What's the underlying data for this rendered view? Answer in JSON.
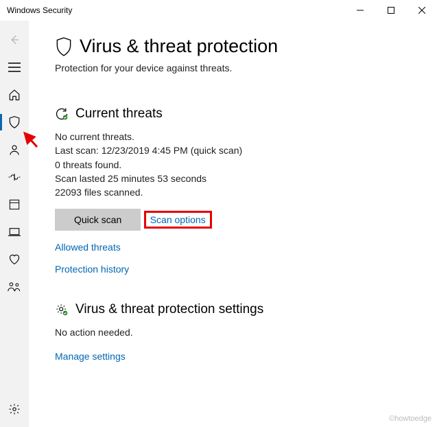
{
  "window": {
    "title": "Windows Security"
  },
  "page": {
    "title": "Virus & threat protection",
    "subtitle": "Protection for your device against threats."
  },
  "current_threats": {
    "heading": "Current threats",
    "line1": "No current threats.",
    "line2": "Last scan: 12/23/2019 4:45 PM (quick scan)",
    "line3": "0 threats found.",
    "line4": "Scan lasted 25 minutes 53 seconds",
    "line5": "22093 files scanned.",
    "quick_scan_label": "Quick scan",
    "scan_options_label": "Scan options",
    "allowed_threats_label": "Allowed threats",
    "protection_history_label": "Protection history"
  },
  "settings": {
    "heading": "Virus & threat protection settings",
    "status": "No action needed.",
    "manage_label": "Manage settings"
  },
  "watermark": "©howtoedge"
}
